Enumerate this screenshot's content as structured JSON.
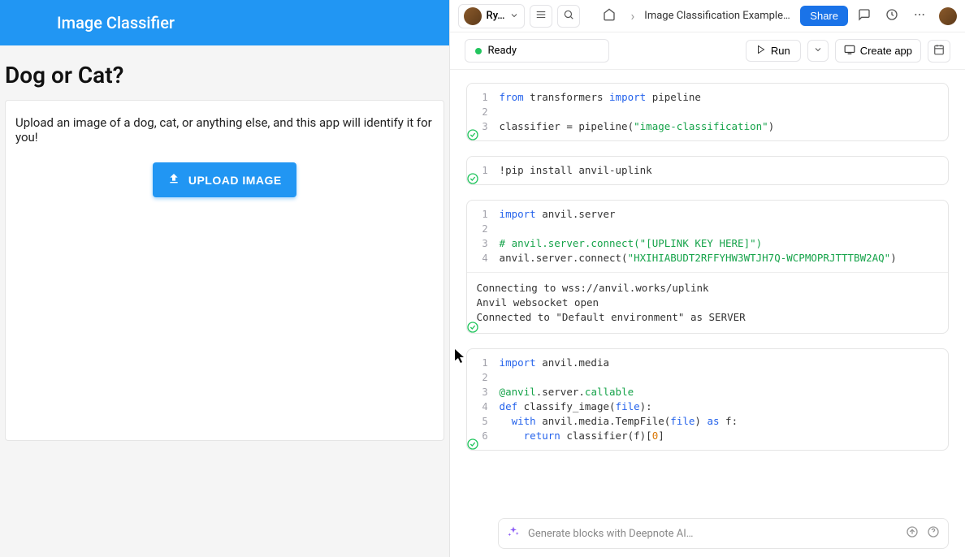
{
  "left": {
    "title": "Image Classifier",
    "heading": "Dog or Cat?",
    "card_text": "Upload an image of a dog, cat, or anything else, and this app will identify it for you!",
    "upload_label": "UPLOAD IMAGE"
  },
  "top": {
    "user_name": "Ry…",
    "breadcrumb": "Image Classification Example …",
    "share_label": "Share"
  },
  "toolbar": {
    "status": "Ready",
    "run_label": "Run",
    "create_app_label": "Create app"
  },
  "cells": [
    {
      "lines": [
        "1",
        "2",
        "3"
      ],
      "code_html": "<span class='kw'>from</span> transformers <span class='kw'>import</span> pipeline\n\nclassifier = pipeline(<span class='str'>\"image-classification\"</span>)"
    },
    {
      "lines": [
        "1"
      ],
      "code_html": "!pip install anvil-uplink"
    },
    {
      "lines": [
        "1",
        "2",
        "3",
        "4"
      ],
      "code_html": "<span class='kw'>import</span> anvil.server\n\n<span class='cmt'># anvil.server.connect(\"[UPLINK KEY HERE]\")</span>\nanvil.server.connect(<span class='str'>\"HXIHIABUDT2RFFYHW3WTJH7Q-WCPMOPRJTTTBW2AQ\"</span>)",
      "output": "Connecting to wss://anvil.works/uplink\nAnvil websocket open\nConnected to \"Default environment\" as SERVER"
    },
    {
      "lines": [
        "1",
        "2",
        "3",
        "4",
        "5",
        "6"
      ],
      "code_html": "<span class='kw'>import</span> anvil.media\n\n<span class='dec'>@anvil</span>.server.<span class='dec'>callable</span>\n<span class='def'>def</span> classify_image(<span class='builtin'>file</span>):\n  <span class='kw'>with</span> anvil.media.TempFile(<span class='builtin'>file</span>) <span class='kw'>as</span> f:\n    <span class='kw'>return</span> classifier(f)[<span class='num'>0</span>]"
    }
  ],
  "ai_bar": {
    "placeholder": "Generate blocks with Deepnote AI…"
  }
}
